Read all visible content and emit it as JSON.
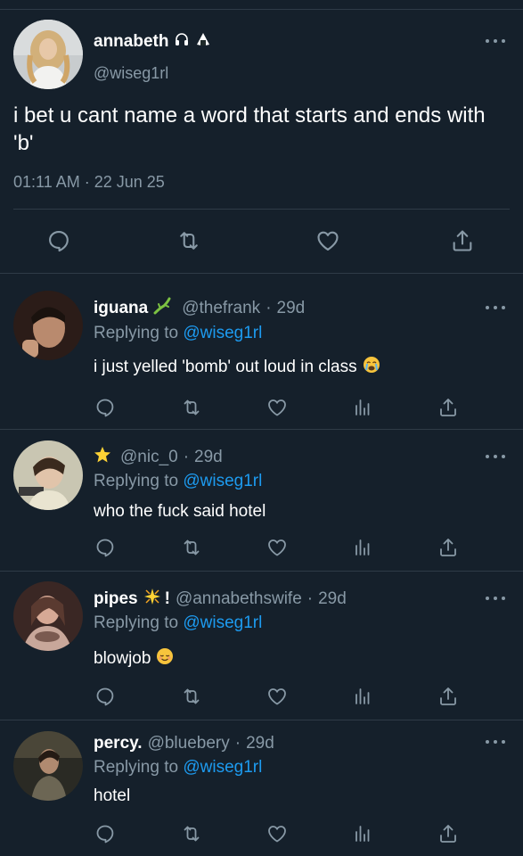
{
  "main": {
    "author_name": "annabeth",
    "author_handle": "@wiseg1rl",
    "text": "i bet u cant name a word that starts and ends with 'b'",
    "timestamp": "01:11 AM · 22 Jun 25",
    "icons": [
      "headphones-icon",
      "onigiri-icon"
    ]
  },
  "replies": [
    {
      "name": "iguana",
      "name_emoji": "lizard-icon",
      "handle": "@thefrank",
      "sep": "·",
      "age": "29d",
      "replying_prefix": "Replying to",
      "replying_to": "@wiseg1rl",
      "text": "i just yelled 'bomb' out loud in class",
      "text_emoji": "crying-face-icon"
    },
    {
      "name": "",
      "name_emoji": "star-icon",
      "handle": "@nic_0",
      "sep": "·",
      "age": "29d",
      "replying_prefix": "Replying to",
      "replying_to": "@wiseg1rl",
      "text": "who the fuck said hotel",
      "text_emoji": ""
    },
    {
      "name": "pipes",
      "name_emoji": "sparkle-star-icon",
      "name_suffix": "!",
      "handle": "@annabethswife",
      "sep": "·",
      "age": "29d",
      "replying_prefix": "Replying to",
      "replying_to": "@wiseg1rl",
      "text": "blowjob",
      "text_emoji": "relieved-face-icon"
    },
    {
      "name": "percy.",
      "name_emoji": "",
      "handle": "@bluebery",
      "sep": "·",
      "age": "29d",
      "replying_prefix": "Replying to",
      "replying_to": "@wiseg1rl",
      "text": "hotel",
      "text_emoji": ""
    }
  ],
  "colors": {
    "background": "#15202b",
    "divider": "#2f3b47",
    "secondary_text": "#8899a6",
    "link": "#1d9bf0"
  }
}
